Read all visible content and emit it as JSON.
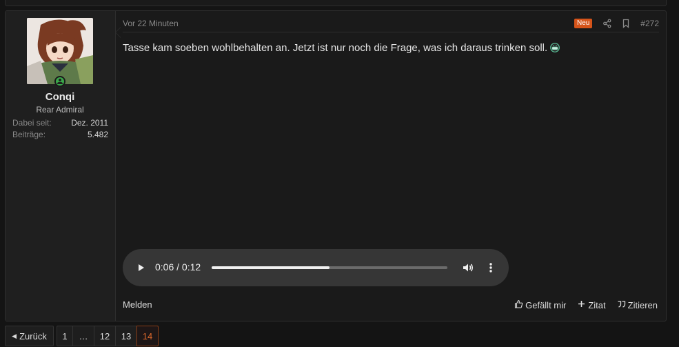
{
  "post": {
    "date": "Vor 22 Minuten",
    "new_badge": "Neu",
    "number": "#272",
    "text": "Tasse kam soeben wohlbehalten an. Jetzt ist nur noch die Frage, was ich daraus trinken soll.",
    "smiley": "grin-smiley-icon"
  },
  "user": {
    "name": "Conqi",
    "title": "Rear Admiral",
    "joined_label": "Dabei seit:",
    "joined_value": "Dez. 2011",
    "posts_label": "Beiträge:",
    "posts_value": "5.482",
    "online": true
  },
  "audio": {
    "time": "0:06 / 0:12",
    "progress": 0.5
  },
  "footer": {
    "report": "Melden",
    "like": "Gefällt mir",
    "quote_add": "Zitat",
    "quote": "Zitieren"
  },
  "pagination": {
    "prev": "Zurück",
    "pages": [
      "1",
      "…",
      "12",
      "13",
      "14"
    ],
    "current": "14"
  },
  "colors": {
    "background": "#141414",
    "panel": "#1a1a1a",
    "accent": "#d6541a",
    "online": "#3aa84a"
  }
}
